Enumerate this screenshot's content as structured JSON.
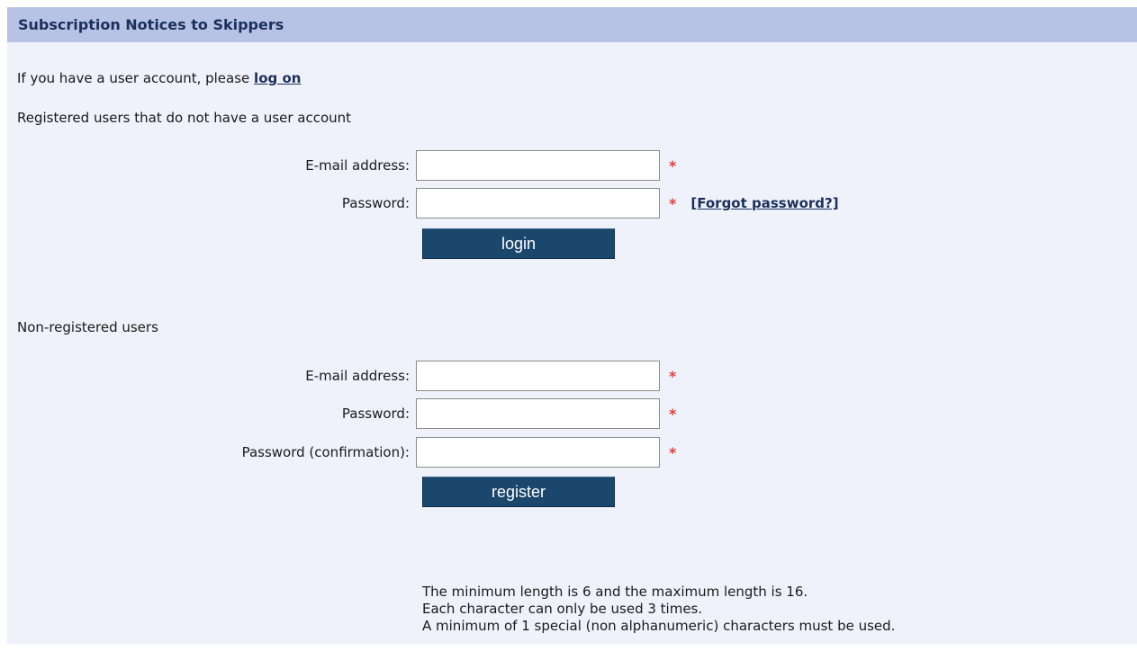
{
  "header": {
    "title": "Subscription Notices to Skippers"
  },
  "intro": {
    "prefix": "If you have a user account, please ",
    "link": "log on"
  },
  "registered": {
    "heading": "Registered users that do not have a user account",
    "email_label": "E-mail address:",
    "email_value": "",
    "password_label": "Password:",
    "password_value": "",
    "required_mark": "*",
    "forgot_link": "[Forgot password?]",
    "login_button": "login"
  },
  "nonregistered": {
    "heading": "Non-registered users",
    "email_label": "E-mail address:",
    "email_value": "",
    "password_label": "Password:",
    "password_value": "",
    "confirm_label": "Password (confirmation):",
    "confirm_value": "",
    "required_mark": "*",
    "register_button": "register"
  },
  "password_rules": [
    "The minimum length is 6 and the maximum length is 16.",
    "Each character can only be used 3 times.",
    "A minimum of 1 special (non alphanumeric) characters must be used."
  ],
  "colors": {
    "header_bg": "#b6c3e4",
    "panel_bg": "#eff2fa",
    "button_bg": "#1b476d",
    "required": "#e04040",
    "link": "#1c2f5c"
  }
}
